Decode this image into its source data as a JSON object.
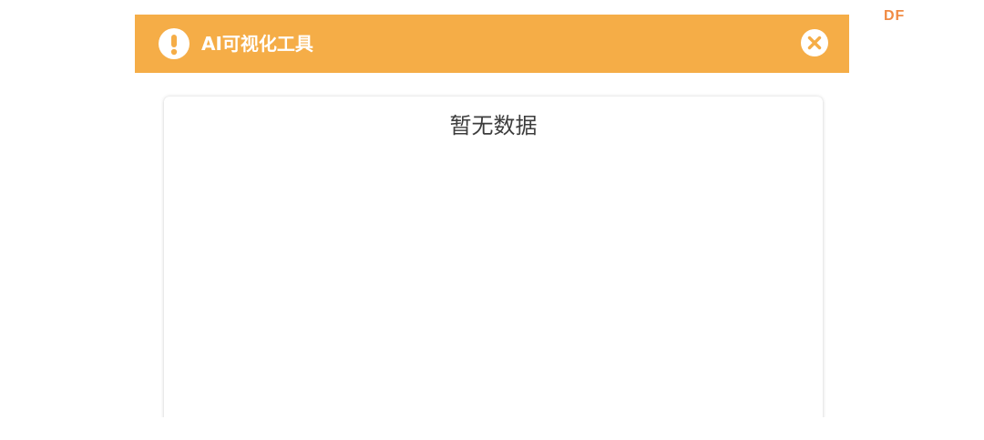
{
  "header": {
    "title": "AI可视化工具",
    "background_color": "#f5ad47",
    "warning_icon": "exclamation-circle-icon",
    "close_icon": "close-circle-icon"
  },
  "brand": {
    "text": "DF",
    "color": "#f08a43"
  },
  "content": {
    "empty_message": "暂无数据"
  }
}
